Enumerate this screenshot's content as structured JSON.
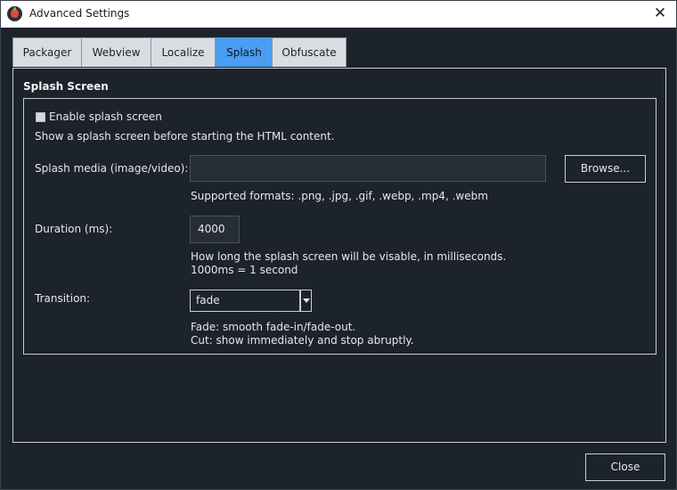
{
  "window": {
    "title": "Advanced Settings",
    "close_glyph": "✕"
  },
  "tabs": [
    {
      "label": "Packager",
      "active": false
    },
    {
      "label": "Webview",
      "active": false
    },
    {
      "label": "Localize",
      "active": false
    },
    {
      "label": "Splash",
      "active": true
    },
    {
      "label": "Obfuscate",
      "active": false
    }
  ],
  "splash": {
    "section_title": "Splash Screen",
    "enable_label": "Enable splash screen",
    "enable_checked": false,
    "description": "Show a splash screen before starting the HTML content.",
    "media_label": "Splash media (image/video):",
    "media_value": "",
    "browse_label": "Browse...",
    "formats_hint": "Supported formats: .png, .jpg, .gif, .webp, .mp4, .webm",
    "duration_label": "Duration (ms):",
    "duration_value": "4000",
    "duration_hint_1": "How long the splash screen will be visable, in milliseconds.",
    "duration_hint_2": "1000ms = 1 second",
    "transition_label": "Transition:",
    "transition_value": "fade",
    "transition_hint_1": "Fade: smooth fade-in/fade-out.",
    "transition_hint_2": "Cut: show immediately and stop abruptly."
  },
  "footer": {
    "close_label": "Close"
  },
  "colors": {
    "background": "#1d232b",
    "active_tab": "#4a9df0",
    "inactive_tab": "#d9dde2"
  }
}
